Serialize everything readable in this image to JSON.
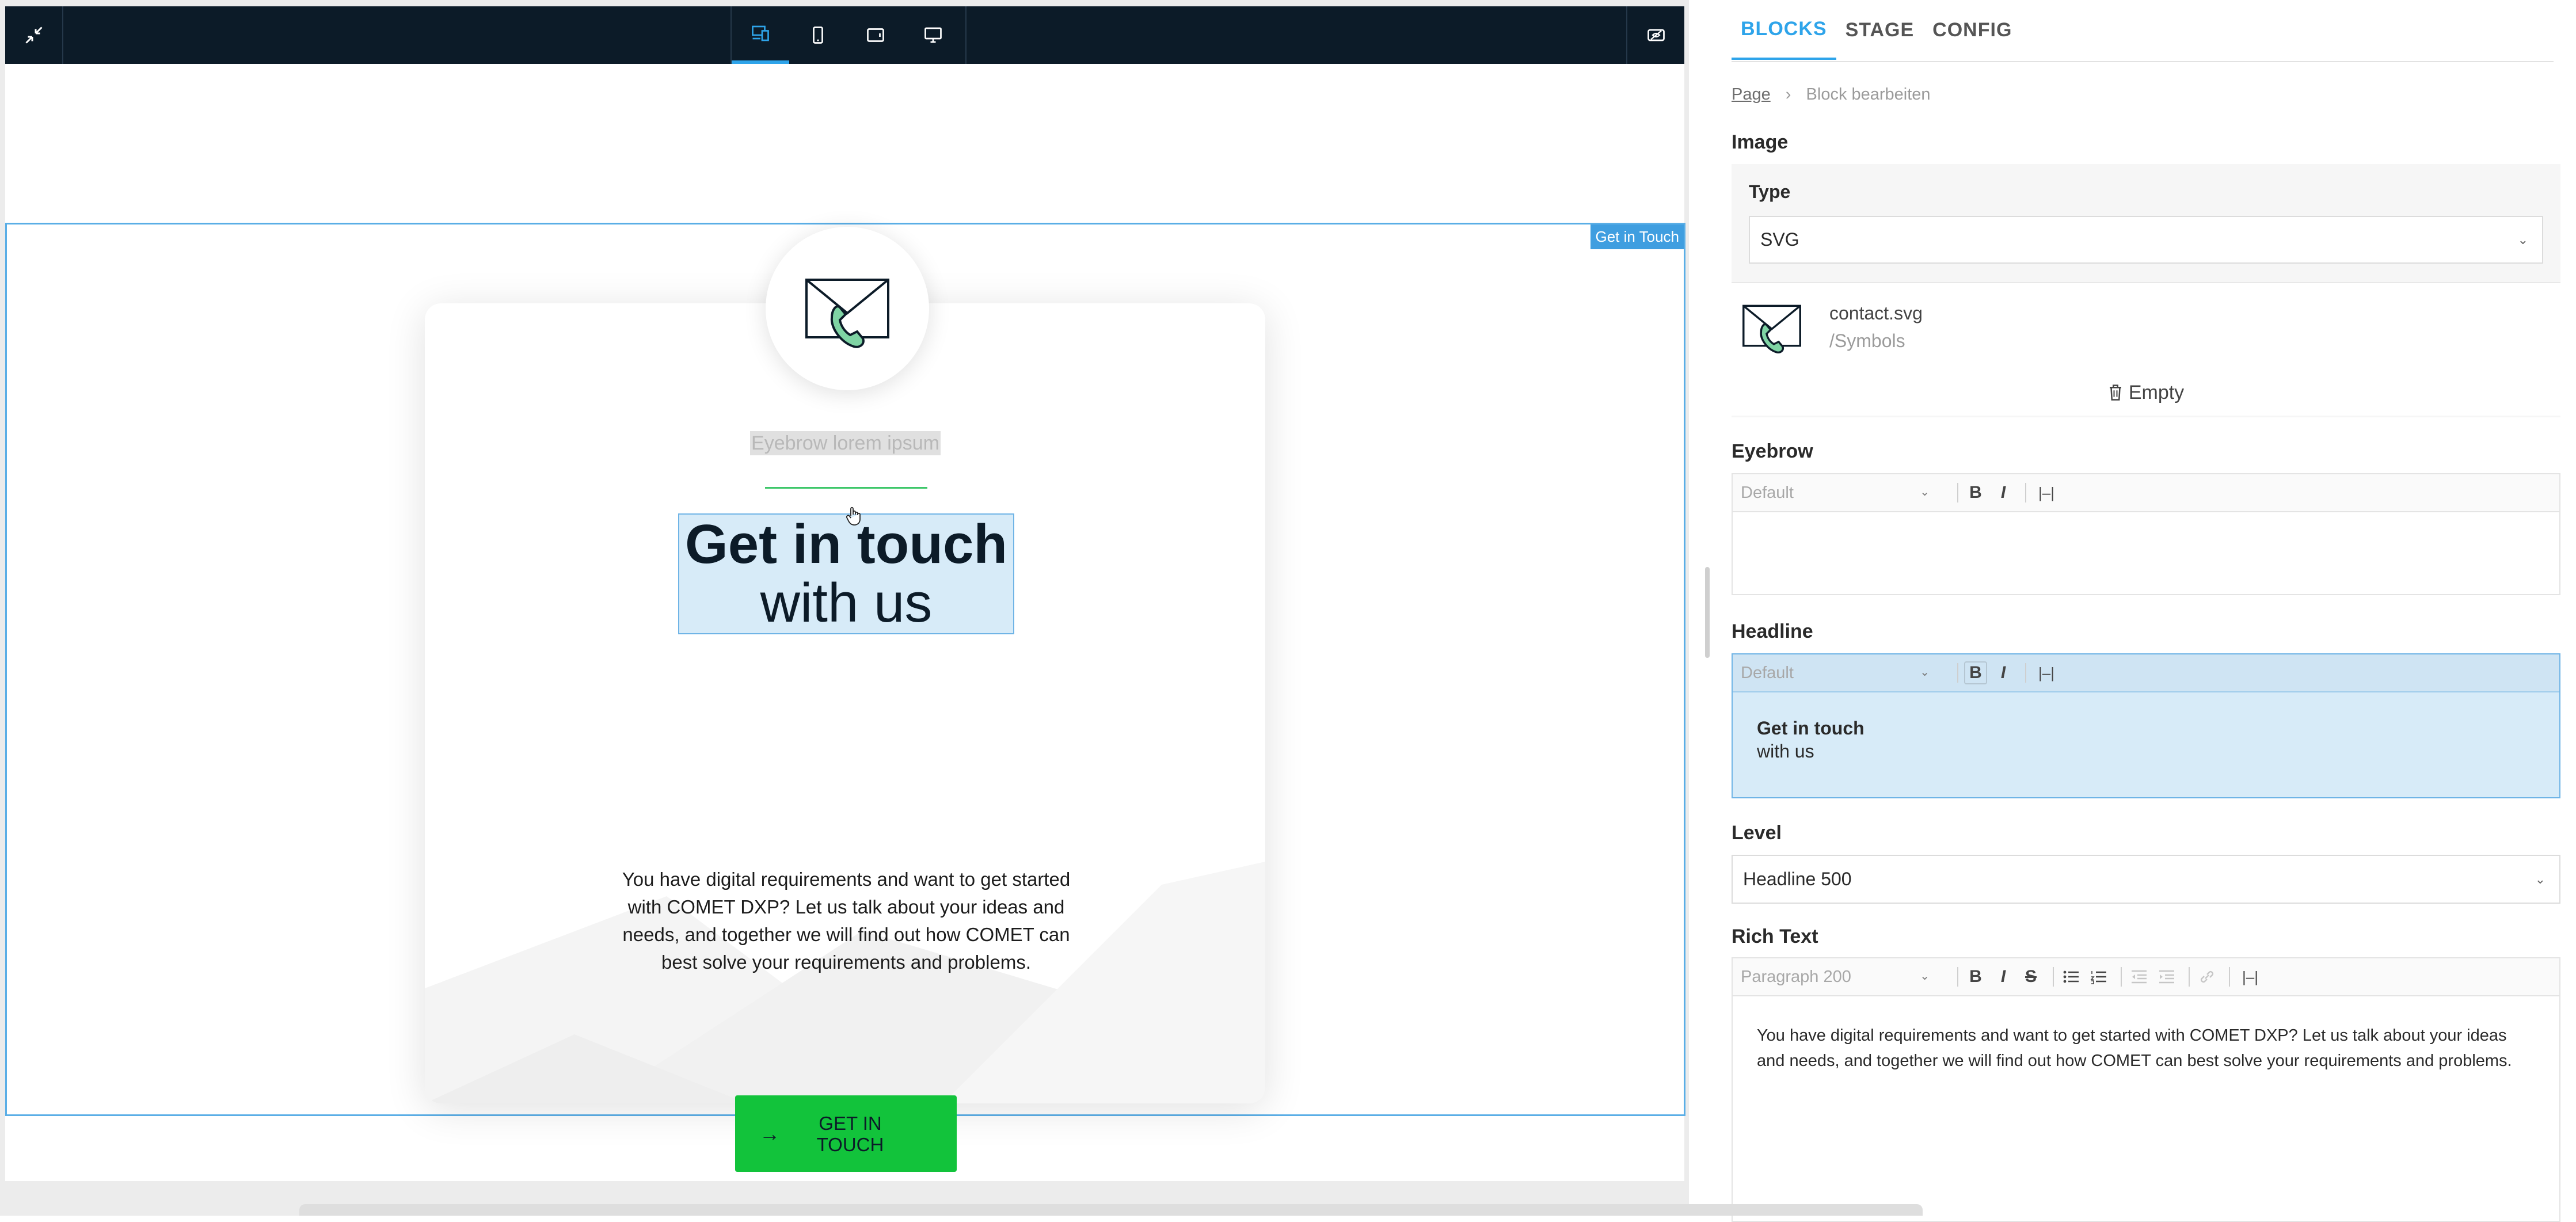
{
  "preview": {
    "stage_tag": "Get in Touch",
    "eyebrow": "Eyebrow lorem ipsum",
    "headline_bold": "Get in touch",
    "headline_light": "with us",
    "body": "You have digital requirements and want to get started with COMET DXP? Let us talk about your ideas and needs, and together we will find out how COMET can best solve your requirements and problems.",
    "cta_arrow": "→",
    "cta_label": "GET IN TOUCH",
    "accent_color": "#12c33b",
    "selection_color": "#2ea4ea"
  },
  "toolbar": {
    "icons": [
      "collapse-icon",
      "responsive-icon",
      "mobile-icon",
      "tablet-icon",
      "desktop-icon",
      "visibility-icon"
    ]
  },
  "panel": {
    "tabs": [
      {
        "label": "BLOCKS"
      },
      {
        "label": "STAGE"
      },
      {
        "label": "CONFIG"
      }
    ],
    "breadcrumb": {
      "page": "Page",
      "separator": "›",
      "current": "Block bearbeiten"
    },
    "image": {
      "section": "Image",
      "type_label": "Type",
      "type_value": "SVG",
      "file_name": "contact.svg",
      "file_path": "/Symbols",
      "empty_label": "Empty"
    },
    "eyebrow": {
      "section": "Eyebrow",
      "style": "Default",
      "value": ""
    },
    "headline": {
      "section": "Headline",
      "style": "Default",
      "line1": "Get in touch",
      "line2": "with us"
    },
    "level": {
      "section": "Level",
      "value": "Headline 500"
    },
    "richtext": {
      "section": "Rich Text",
      "style": "Paragraph 200",
      "value": "You have digital requirements and want to get started with COMET DXP? Let us talk about your ideas and needs, and together we will find out how COMET can best solve your requirements and problems."
    },
    "toolbar_glyphs": {
      "bold": "B",
      "italic": "I",
      "strike": "S",
      "divider": "|–|",
      "chevron": "⌄"
    }
  }
}
